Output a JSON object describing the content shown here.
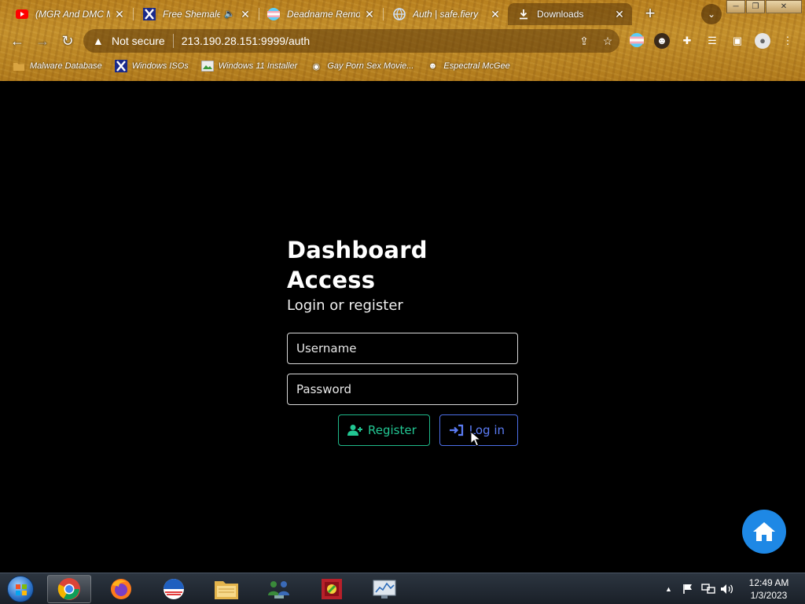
{
  "browser": {
    "tabs": [
      {
        "title": "(MGR And DMC M",
        "icon": "youtube-icon"
      },
      {
        "title": "Free Shemale",
        "icon": "x-site-icon",
        "audio": true
      },
      {
        "title": "Deadname Remov",
        "icon": "trans-flag-icon"
      },
      {
        "title": "Auth | safe.fiery",
        "icon": "globe-icon"
      },
      {
        "title": "Downloads",
        "icon": "download-icon"
      }
    ],
    "address": {
      "security": "Not secure",
      "url": "213.190.28.151:9999/auth"
    },
    "bookmarks": [
      {
        "label": "Malware Database",
        "icon": "folder-icon"
      },
      {
        "label": "Windows ISOs",
        "icon": "x-site-icon"
      },
      {
        "label": "Windows 11 Installer",
        "icon": "image-icon"
      },
      {
        "label": "Gay Porn Sex Movie...",
        "icon": "site-icon"
      },
      {
        "label": "Espectral McGee",
        "icon": "avatar-icon"
      }
    ]
  },
  "auth": {
    "title": "Dashboard Access",
    "subtitle": "Login or register",
    "username_placeholder": "Username",
    "password_placeholder": "Password",
    "register_label": "Register",
    "login_label": "Log in"
  },
  "taskbar": {
    "time": "12:49 AM",
    "date": "1/3/2023"
  },
  "colors": {
    "register": "#22c793",
    "login": "#5b7cf5",
    "home_fab": "#1e88e5"
  }
}
